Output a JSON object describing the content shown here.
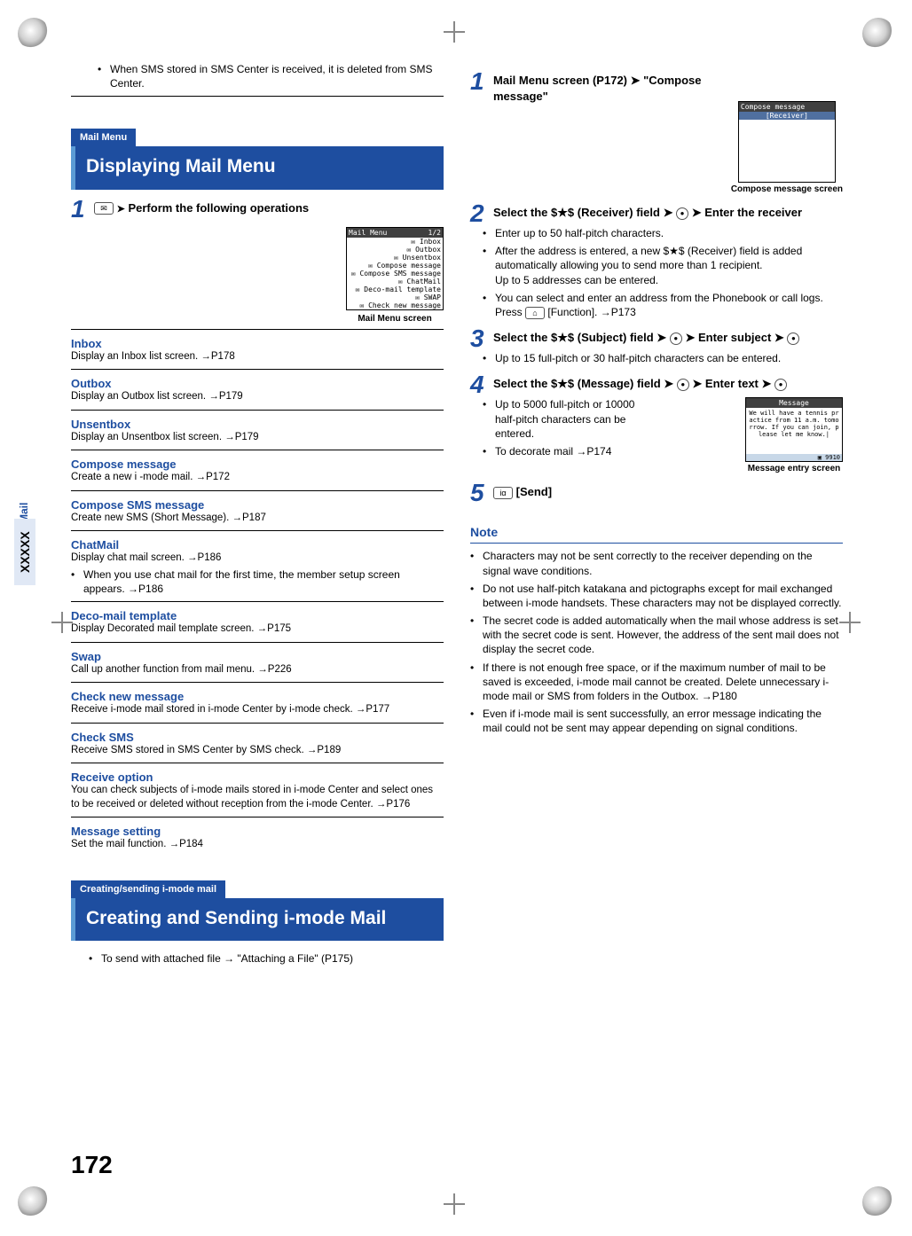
{
  "page_number": "172",
  "side_label": "Mail",
  "side_x": "XXXXX",
  "intro_bullet": "When SMS stored in SMS Center is received, it is deleted from SMS Center.",
  "sec1": {
    "tag": "Mail Menu",
    "title": "Displaying Mail Menu",
    "step1_text": "Perform the following operations",
    "shot": {
      "title": "Mail Menu",
      "page": "1/2",
      "rows": [
        "Inbox",
        "Outbox",
        "Unsentbox",
        "Compose message",
        "Compose SMS message",
        "ChatMail",
        "Deco-mail template",
        "SWAP",
        "Check new message"
      ],
      "caption": "Mail Menu screen"
    }
  },
  "menu_items": [
    {
      "t": "Inbox",
      "d": "Display an Inbox list screen. →P178"
    },
    {
      "t": "Outbox",
      "d": "Display an Outbox list screen. →P179"
    },
    {
      "t": "Unsentbox",
      "d": "Display an Unsentbox list screen. →P179"
    },
    {
      "t": "Compose message",
      "d": "Create a new i -mode mail. →P172"
    },
    {
      "t": "Compose SMS message",
      "d": "Create new SMS (Short Message). →P187"
    },
    {
      "t": "ChatMail",
      "d": "Display chat mail screen. →P186",
      "sub": "When you use chat mail for the first time, the member setup screen appears. →P186"
    },
    {
      "t": "Deco-mail template",
      "d": "Display Decorated mail template screen. →P175"
    },
    {
      "t": "Swap",
      "d": "Call up another function from mail menu. →P226"
    },
    {
      "t": "Check new message",
      "d": "Receive i-mode mail stored in i-mode Center by i-mode check. →P177"
    },
    {
      "t": "Check SMS",
      "d": "Receive SMS stored in SMS Center by SMS check. →P189"
    },
    {
      "t": "Receive option",
      "d": "You can check subjects of i-mode mails stored in i-mode Center and select ones to be received or deleted without reception from the i-mode Center. →P176"
    },
    {
      "t": "Message setting",
      "d": "Set the mail function. →P184"
    }
  ],
  "sec2": {
    "tag": "Creating/sending i-mode mail",
    "title": "Creating and Sending i-mode Mail",
    "bullet": "To send with attached file → \"Attaching a File\" (P175)"
  },
  "right": {
    "step1": "Mail Menu screen (P172) ➤ \"Compose message\"",
    "shot1_caption": "Compose message screen",
    "shot1_title": "Compose message",
    "shot1_row": "[Receiver]",
    "step2_head": "Select the $★$ (Receiver) field ➤",
    "step2_tail": "➤ Enter the receiver",
    "step2_b1": "Enter up to 50 half-pitch characters.",
    "step2_b2": "After the address is entered, a new $★$ (Receiver) field is added automatically allowing you to send more than 1 recipient.",
    "step2_b2b": "Up to 5 addresses can be entered.",
    "step2_b3a": "You can select and enter an address from the Phonebook or call logs. Press ",
    "step2_b3b": " [Function]. →P173",
    "step3_head": "Select the $★$ (Subject) field ➤",
    "step3_tail": "➤ Enter subject ➤",
    "step3_b1": "Up to 15 full-pitch or 30 half-pitch characters can be entered.",
    "step4_head": "Select the $★$ (Message) field ➤",
    "step4_tail": "➤ Enter text ➤",
    "step4_b1": "Up to 5000 full-pitch or 10000 half-pitch characters can be entered.",
    "step4_b2": "To decorate mail →P174",
    "shot2_caption": "Message entry screen",
    "shot2_title": "Message",
    "shot2_body": "We will have a tennis pr\nactice from 11 a.m. tomo\nrrow. If you can join, p\nlease let me know.|",
    "shot2_count": "9910",
    "step5": " [Send]",
    "note_label": "Note",
    "notes": [
      "Characters may not be sent correctly to the receiver depending on the signal wave conditions.",
      "Do not use half-pitch katakana and pictographs except for mail exchanged between i-mode handsets. These characters may not be displayed correctly.",
      "The secret code is added automatically when the mail whose address is set with the secret code is sent. However, the address of the sent mail does not display the secret code.",
      "If there is not enough free space, or if the maximum number of mail to be saved is exceeded, i-mode mail cannot be created. Delete unnecessary i-mode mail or SMS from folders in the Outbox. →P180",
      "Even if i-mode mail is sent successfully, an error message indicating the mail could not be sent may appear depending on signal conditions."
    ]
  }
}
